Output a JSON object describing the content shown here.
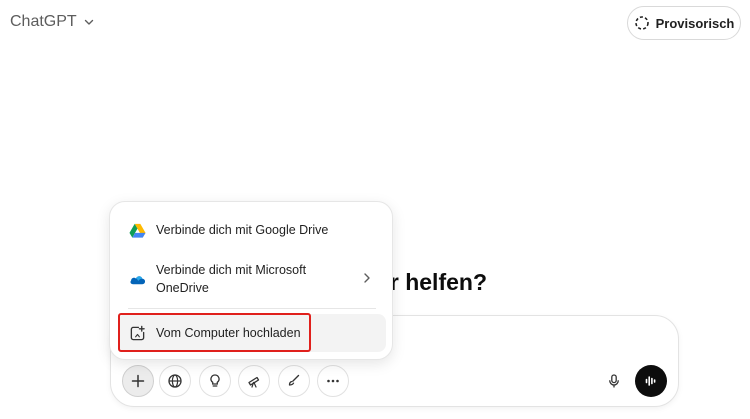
{
  "header": {
    "title": "ChatGPT",
    "temporary_label": "Provisorisch"
  },
  "main": {
    "headline_visible": "h dir helfen?"
  },
  "attach_menu": {
    "items": [
      {
        "label": "Verbinde dich mit Google Drive",
        "icon": "google-drive-icon"
      },
      {
        "label": "Verbinde dich mit Microsoft OneDrive",
        "icon": "onedrive-icon"
      },
      {
        "label": "Vom Computer hochladen",
        "icon": "upload-file-icon"
      }
    ],
    "highlight_color": "#e0201c"
  },
  "composer": {
    "tools": [
      "plus-icon",
      "globe-icon",
      "lightbulb-icon",
      "telescope-icon",
      "paintbrush-icon",
      "more-icon"
    ],
    "right": [
      "microphone-icon",
      "voice-mode-icon"
    ]
  },
  "colors": {
    "text": "#0d0d0d",
    "muted": "#5d5d5d",
    "voice_button": "#0d0d0d",
    "onedrive_blue": "#0364b8"
  }
}
